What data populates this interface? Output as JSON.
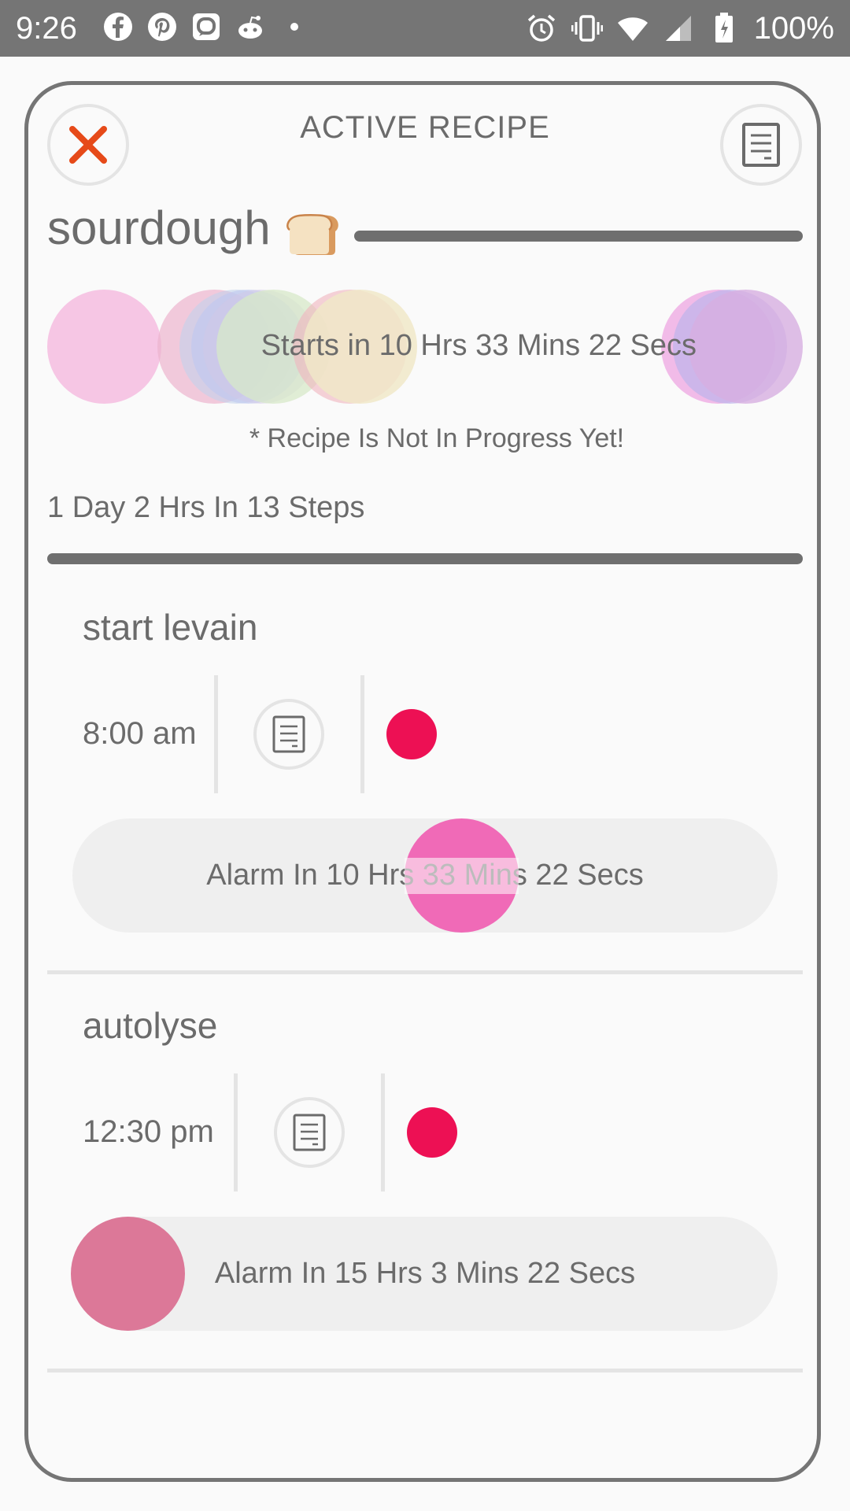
{
  "status_bar": {
    "time": "9:26",
    "battery": "100%",
    "left_icons": [
      "facebook-icon",
      "pinterest-icon",
      "messaging-icon",
      "reddit-icon",
      "dot-icon"
    ],
    "right_icons": [
      "alarm-icon",
      "vibrate-icon",
      "wifi-icon",
      "signal-icon",
      "battery-charging-icon"
    ]
  },
  "header": {
    "title": "ACTIVE RECIPE"
  },
  "recipe": {
    "name": "sourdough",
    "emoji_icon": "bread-icon",
    "starts_in": "Starts in 10 Hrs 33 Mins 22 Secs",
    "not_in_progress": "* Recipe Is Not In Progress Yet!",
    "duration_summary": "1 Day 2 Hrs In 13 Steps"
  },
  "steps": [
    {
      "name": "start levain",
      "time": "8:00 am",
      "alarm": "Alarm In 10 Hrs 33 Mins 22 Secs",
      "status_color": "#ed1054"
    },
    {
      "name": "autolyse",
      "time": "12:30 pm",
      "alarm": "Alarm In 15 Hrs 3 Mins 22 Secs",
      "status_color": "#ed1054"
    }
  ],
  "colors": {
    "close_icon": "#e64a19",
    "accent_pink": "#f06ab7",
    "status_dot": "#ed1054",
    "rule": "#6f6f6f"
  }
}
